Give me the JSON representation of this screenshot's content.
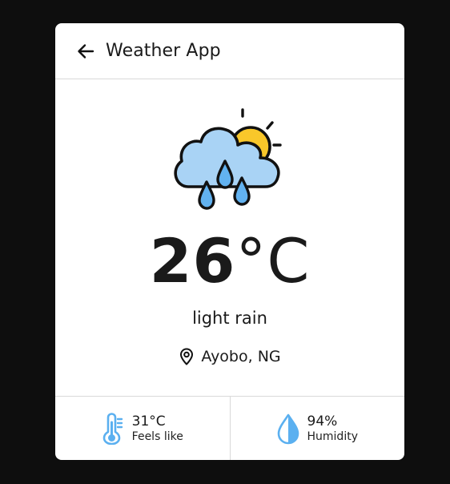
{
  "app": {
    "title": "Weather App"
  },
  "weather": {
    "condition_icon": "cloud-rain-sun-icon",
    "temperature_value": "26",
    "temperature_unit": "°C",
    "description": "light rain",
    "location": "Ayobo, NG"
  },
  "stats": {
    "feels_like": {
      "value": "31°C",
      "label": "Feels like",
      "icon": "thermometer-icon"
    },
    "humidity": {
      "value": "94%",
      "label": "Humidity",
      "icon": "water-drop-icon"
    }
  },
  "colors": {
    "background": "#0e0e0e",
    "card": "#ffffff",
    "cloud": "#a9d3f5",
    "sun": "#f9c72a",
    "rain": "#62b2f0",
    "accent_icons": "#5bb0f0"
  }
}
